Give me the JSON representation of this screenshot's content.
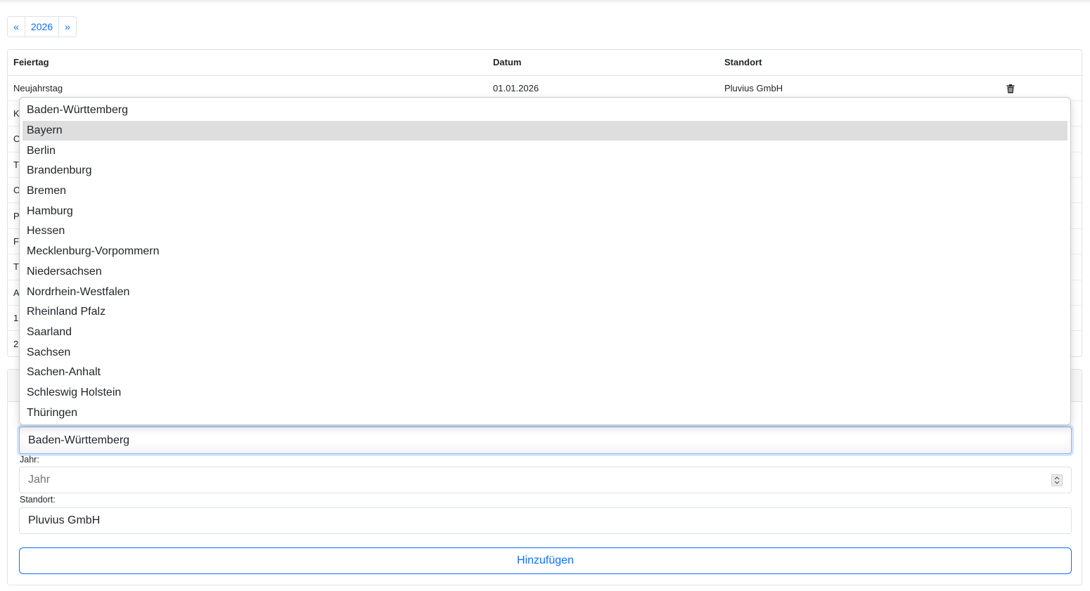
{
  "pager": {
    "prev": "«",
    "year": "2026",
    "next": "»"
  },
  "table": {
    "headers": {
      "name": "Feiertag",
      "date": "Datum",
      "location": "Standort"
    },
    "first_row": {
      "name": "Neujahrstag",
      "date": "01.01.2026",
      "location": "Pluvius GmbH"
    },
    "hidden_rows_initials": [
      "K",
      "O",
      "T",
      "C",
      "P",
      "F",
      "T",
      "A",
      "1",
      "2"
    ]
  },
  "form": {
    "state_value": "Baden-Württemberg",
    "year_label": "Jahr:",
    "year_placeholder": "Jahr",
    "location_label": "Standort:",
    "location_value": "Pluvius GmbH",
    "submit_label": "Hinzufügen"
  },
  "dropdown": {
    "selected_index": 1,
    "options": [
      "Baden-Württemberg",
      "Bayern",
      "Berlin",
      "Brandenburg",
      "Bremen",
      "Hamburg",
      "Hessen",
      "Mecklenburg-Vorpommern",
      "Niedersachsen",
      "Nordrhein-Westfalen",
      "Rheinland Pfalz",
      "Saarland",
      "Sachsen",
      "Sachen-Anhalt",
      "Schleswig Holstein",
      "Thüringen"
    ]
  },
  "colors": {
    "accent": "#0d6efd",
    "border": "#dee2e6",
    "highlight": "#dedede"
  }
}
